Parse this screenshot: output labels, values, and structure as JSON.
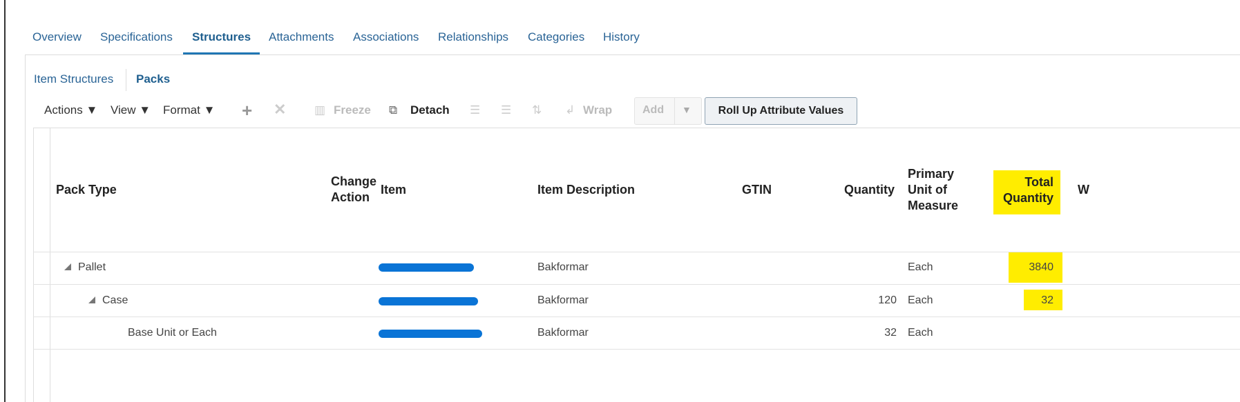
{
  "tabs": [
    "Overview",
    "Specifications",
    "Structures",
    "Attachments",
    "Associations",
    "Relationships",
    "Categories",
    "History"
  ],
  "active_tab": "Structures",
  "subtabs": [
    "Item Structures",
    "Packs"
  ],
  "toolbar": {
    "actions": "Actions",
    "view": "View",
    "format": "Format",
    "freeze": "Freeze",
    "detach": "Detach",
    "wrap": "Wrap",
    "add": "Add",
    "rollup": "Roll Up Attribute Values"
  },
  "columns": {
    "pack_type": "Pack Type",
    "change_action_1": "Change",
    "change_action_2": "Action",
    "item": "Item",
    "item_description": "Item Description",
    "gtin": "GTIN",
    "quantity": "Quantity",
    "uom_1": "Primary",
    "uom_2": "Unit of",
    "uom_3": "Measure",
    "total_1": "Total",
    "total_2": "Quantity",
    "partial": "W"
  },
  "rows": [
    {
      "pack_type": "Pallet",
      "description": "Bakformar",
      "quantity": "",
      "uom": "Each",
      "total": "3840"
    },
    {
      "pack_type": "Case",
      "description": "Bakformar",
      "quantity": "120",
      "uom": "Each",
      "total": "32"
    },
    {
      "pack_type": "Base Unit or Each",
      "description": "Bakformar",
      "quantity": "32",
      "uom": "Each",
      "total": ""
    }
  ],
  "colors": {
    "highlight": "#ffed00",
    "redaction": "#0a74d6",
    "link": "#2a6496"
  }
}
